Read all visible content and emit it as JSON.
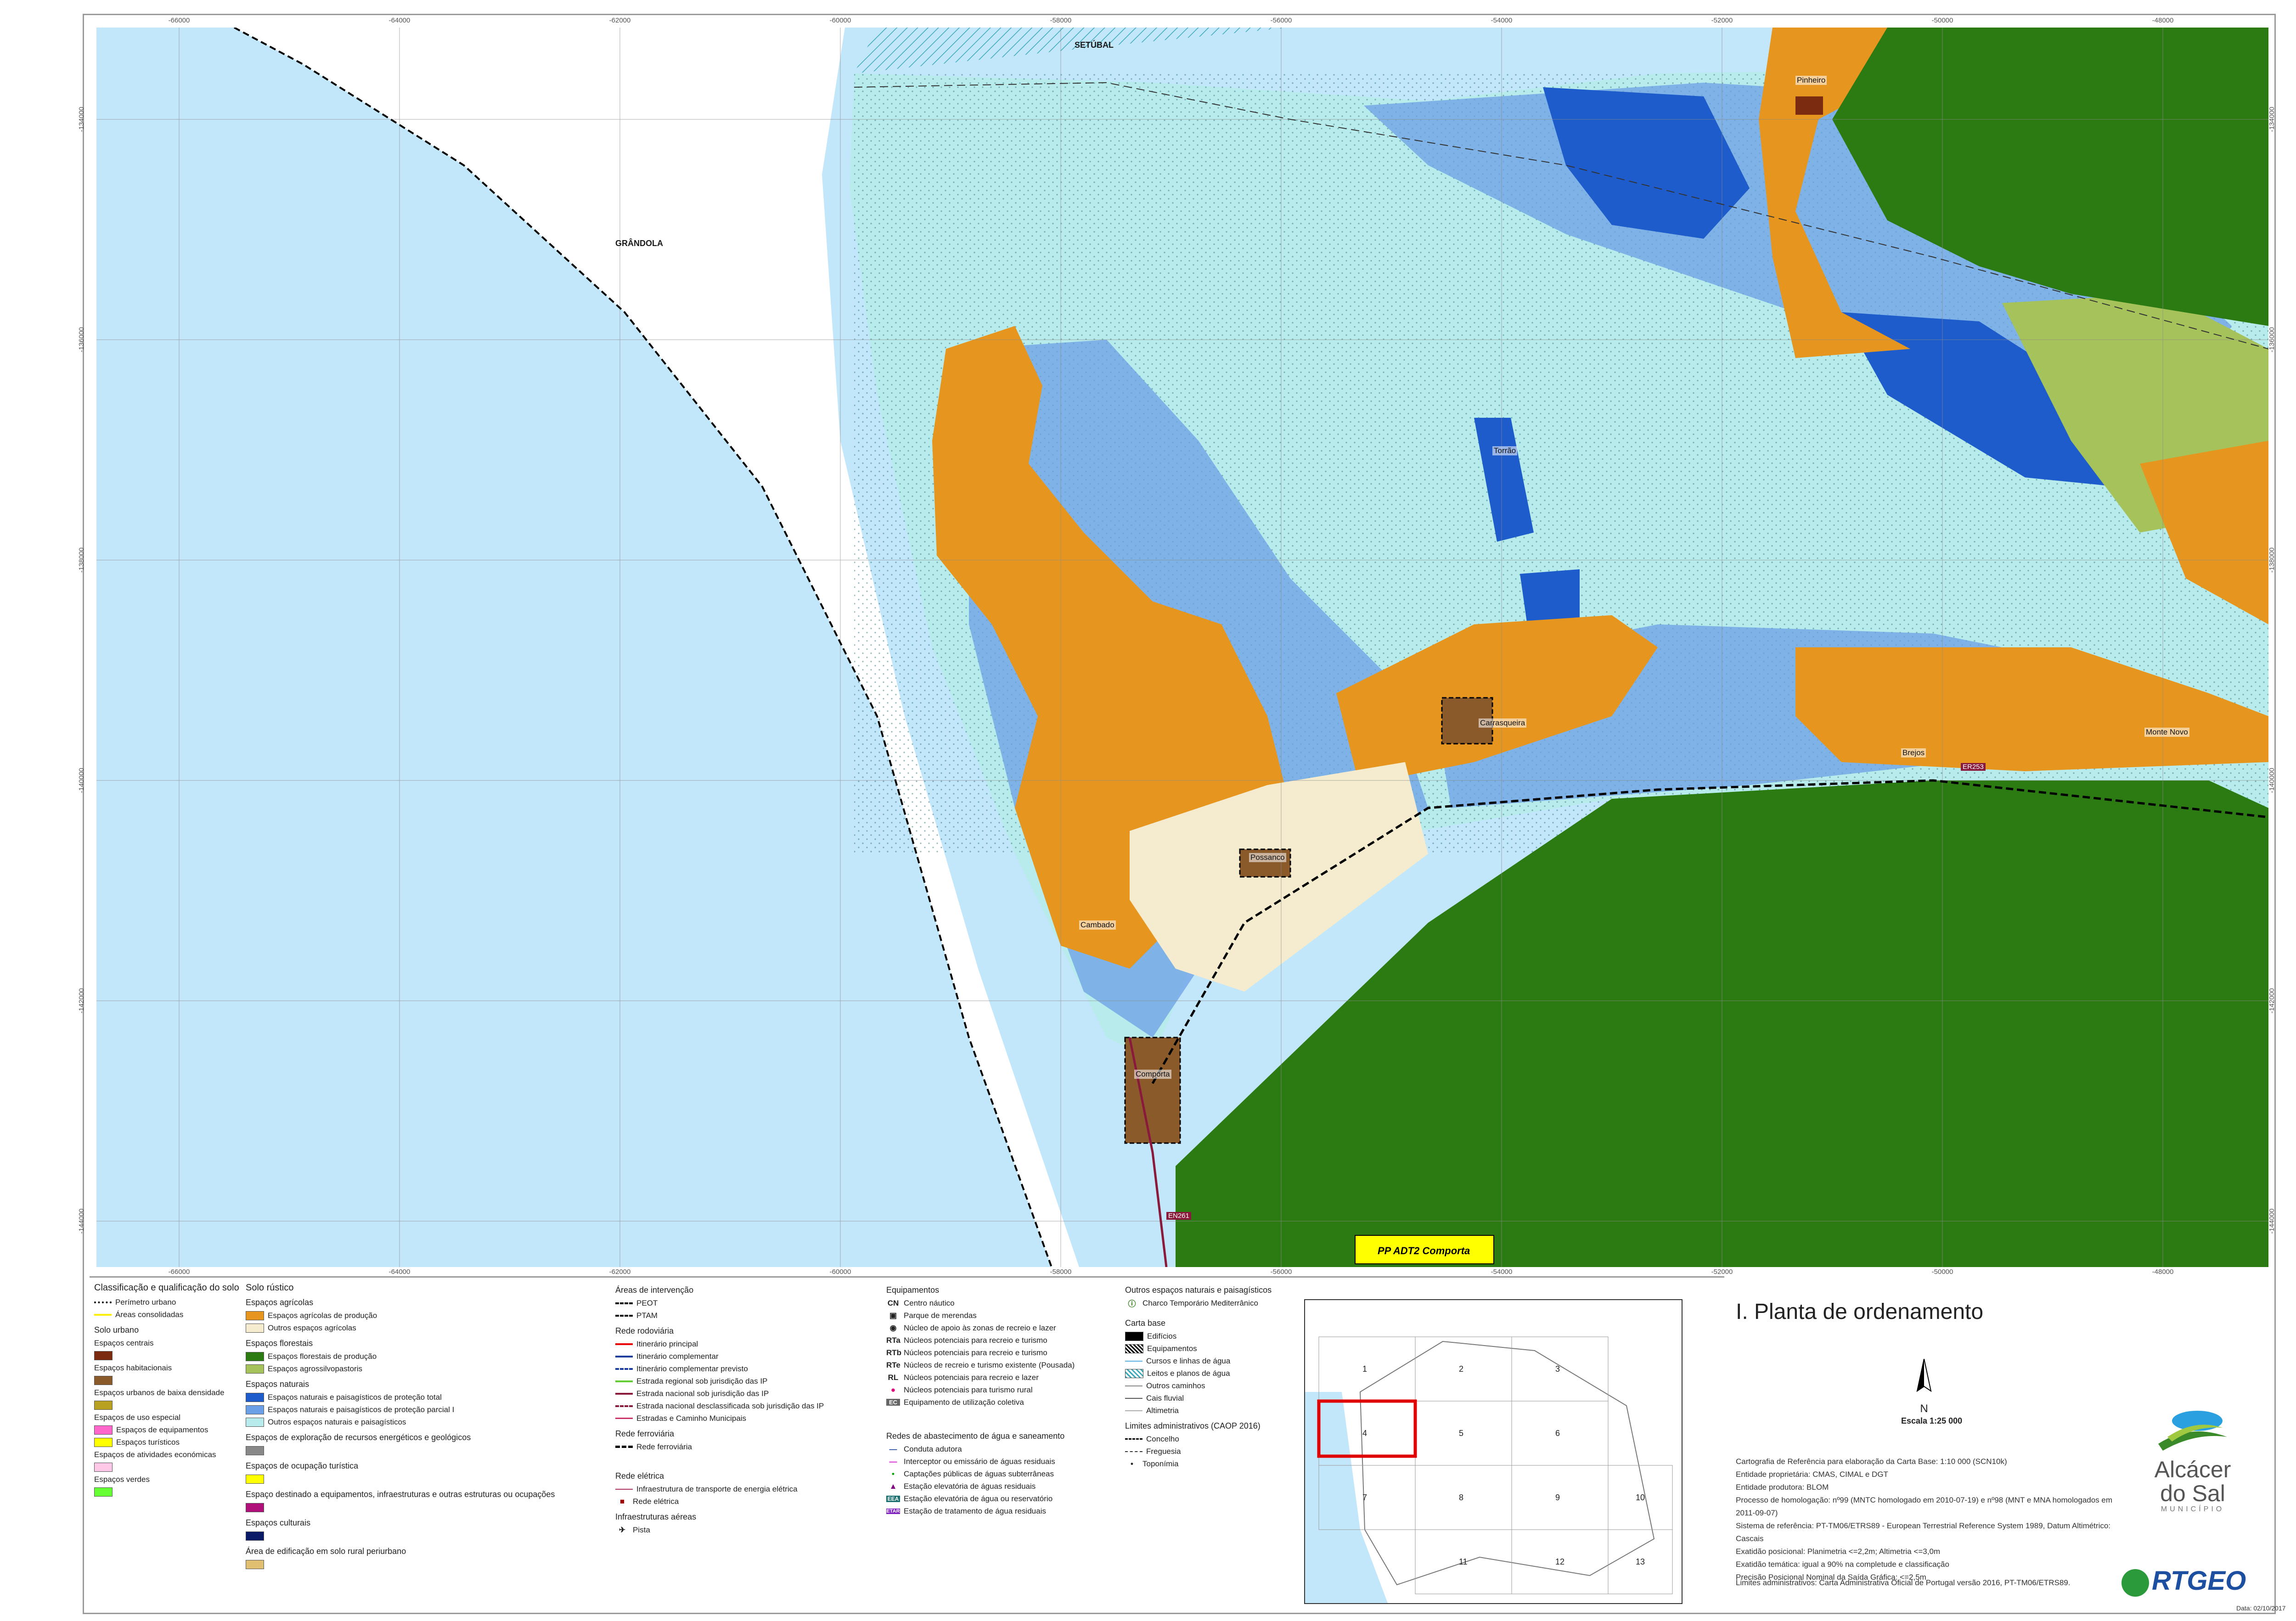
{
  "map": {
    "coords_top": [
      "-66000",
      "-64000",
      "-62000",
      "-60000",
      "-58000",
      "-56000",
      "-54000",
      "-52000",
      "-50000",
      "-48000"
    ],
    "coords_side": [
      "-134000",
      "-136000",
      "-138000",
      "-140000",
      "-142000",
      "-144000"
    ],
    "labels": {
      "setubal": "SETÚBAL",
      "grandola": "GRÂNDOLA"
    },
    "places": {
      "pinheiro": "Pinheiro",
      "torrao": "Torrão",
      "carrasqueira": "Carrasqueira",
      "possanco": "Possanco",
      "comporta": "Comporta",
      "monte_novo": "Monte Novo",
      "brejos": "Brejos",
      "cambado": "Cambado"
    },
    "roads": {
      "en253": "ER253",
      "en261": "EN261"
    },
    "pp_label": "PP ADT2 Comporta"
  },
  "legend": {
    "col1": {
      "heading": "Classificação e qualificação do solo",
      "items": [
        {
          "label": "Perímetro urbano",
          "type": "dash",
          "color": "#000000"
        },
        {
          "label": "Áreas consolidadas",
          "type": "line",
          "color": "#ffee00"
        }
      ],
      "urbano": "Solo urbano",
      "urbano_items": [
        {
          "label": "Espaços centrais",
          "color": "#7a2b10"
        },
        {
          "label": "Espaços habitacionais",
          "color": "#8a5a2a"
        },
        {
          "label": "Espaços urbanos de baixa densidade",
          "color": "#b8a020"
        },
        {
          "label": "Espaços de uso especial",
          "color": ""
        },
        {
          "label": "Espaços de equipamentos",
          "color": "#ff66cc"
        },
        {
          "label": "Espaços turísticos",
          "color": "#ffff00"
        },
        {
          "label": "Espaços de atividades económicas",
          "color": "#ffc8e6"
        },
        {
          "label": "Espaços verdes",
          "color": "#66ff33"
        }
      ]
    },
    "col2": {
      "heading": "Solo rústico",
      "groups": [
        {
          "title": "Espaços agrícolas",
          "items": [
            {
              "label": "Espaços agrícolas de produção",
              "color": "#e6961e"
            },
            {
              "label": "Outros espaços agrícolas",
              "color": "#f5ecd0"
            }
          ]
        },
        {
          "title": "Espaços florestais",
          "items": [
            {
              "label": "Espaços florestais de produção",
              "color": "#2b7a12"
            },
            {
              "label": "Espaços agrossilvopastoris",
              "color": "#a6c25a"
            }
          ]
        },
        {
          "title": "Espaços naturais",
          "items": [
            {
              "label": "Espaços naturais e paisagísticos de proteção total",
              "color": "#1e5ccc"
            },
            {
              "label": "Espaços naturais e paisagísticos de proteção parcial I",
              "color": "#6ca0e6"
            },
            {
              "label": "Outros espaços naturais e paisagísticos",
              "color": "#b8ecec"
            }
          ]
        },
        {
          "title": "Espaços de exploração de recursos energéticos e geológicos",
          "items": [
            {
              "label": "",
              "color": "#888888"
            }
          ]
        },
        {
          "title": "Espaços de ocupação turística",
          "items": [
            {
              "label": "",
              "color": "#ffff00"
            }
          ]
        },
        {
          "title": "Espaço destinado a equipamentos, infraestruturas e outras estruturas ou ocupações",
          "items": [
            {
              "label": "",
              "color": "#b0107a"
            }
          ]
        },
        {
          "title": "Espaços culturais",
          "items": [
            {
              "label": "",
              "color": "#0a1a66"
            }
          ]
        },
        {
          "title": "Área de edificação em solo rural periurbano",
          "items": [
            {
              "label": "",
              "color": "#e0c070"
            }
          ]
        }
      ]
    },
    "col3": {
      "areas_heading": "Áreas de intervenção",
      "areas": [
        "PEOT",
        "PTAM"
      ],
      "rodo_heading": "Rede rodoviária",
      "rodo": [
        {
          "label": "Itinerário principal",
          "color": "#e60000",
          "style": "solid"
        },
        {
          "label": "Itinerário complementar",
          "color": "#1a3c9c",
          "style": "solid"
        },
        {
          "label": "Itinerário complementar previsto",
          "color": "#1a3c9c",
          "style": "dashed"
        },
        {
          "label": "Estrada regional sob jurisdição das IP",
          "color": "#66cc33",
          "style": "solid"
        },
        {
          "label": "Estrada nacional sob jurisdição das IP",
          "color": "#8a1a3c",
          "style": "solid"
        },
        {
          "label": "Estrada nacional desclassificada sob jurisdição das IP",
          "color": "#8a1a3c",
          "style": "dashed"
        },
        {
          "label": "Estradas e Caminho Municipais",
          "color": "#cc3366",
          "style": "solid"
        }
      ],
      "ferro_heading": "Rede ferroviária",
      "ferro": "Rede ferroviária",
      "elec_heading": "Rede elétrica",
      "elec": [
        "Infraestrutura de transporte de energia elétrica",
        "Rede elétrica"
      ],
      "aereo_heading": "Infraestruturas aéreas",
      "aereo": "Pista"
    },
    "col4": {
      "heading": "Equipamentos",
      "items": [
        {
          "code": "CN",
          "label": "Centro náutico"
        },
        {
          "code": "▣",
          "label": "Parque de merendas"
        },
        {
          "code": "◉",
          "label": "Núcleo de apoio às zonas de recreio e lazer"
        },
        {
          "code": "RTa",
          "label": "Núcleos potenciais para recreio e turismo"
        },
        {
          "code": "RTb",
          "label": "Núcleos potenciais para recreio e turismo"
        },
        {
          "code": "RTe",
          "label": "Núcleos de recreio e turismo existente (Pousada)"
        },
        {
          "code": "RL",
          "label": "Núcleos potenciais para recreio e lazer"
        },
        {
          "code": "●",
          "label": "Núcleos potenciais para turismo rural"
        },
        {
          "code": "EC",
          "label": "Equipamento de utilização coletiva"
        }
      ],
      "agua_heading": "Redes de abastecimento de água e saneamento",
      "agua": [
        {
          "code": "—",
          "label": "Conduta adutora"
        },
        {
          "code": "—",
          "label": "Interceptor ou emissário de águas residuais"
        },
        {
          "code": "•",
          "label": "Captações públicas de águas subterrâneas"
        },
        {
          "code": "▲",
          "label": "Estação elevatória de águas residuais"
        },
        {
          "code": "EEA",
          "label": "Estação elevatória de água ou reservatório"
        },
        {
          "code": "ETAR",
          "label": "Estação de tratamento de água residuais"
        }
      ]
    },
    "col5": {
      "heading": "Outros espaços naturais e paisagísticos",
      "charco": "Charco Temporário Mediterrânico",
      "base_heading": "Carta base",
      "base": [
        "Edifícios",
        "Equipamentos",
        "Cursos e linhas de água",
        "Leitos e planos de água",
        "Outros caminhos",
        "Cais fluvial",
        "Altimetria"
      ],
      "limites_heading": "Limites administrativos (CAOP 2016)",
      "limites": [
        "Concelho",
        "Freguesia",
        "Toponímia"
      ]
    }
  },
  "inset": {
    "cells": [
      "1",
      "2",
      "3",
      "4",
      "5",
      "6",
      "7",
      "8",
      "9",
      "10",
      "11",
      "12",
      "13"
    ]
  },
  "title": "I. Planta de ordenamento",
  "north": "N",
  "scale": "Escala 1:25 000",
  "meta": [
    "Cartografia de Referência para elaboração da Carta Base: 1:10 000 (SCN10k)",
    "Entidade proprietária: CMAS, CIMAL e DGT",
    "Entidade produtora: BLOM",
    "Processo de homologação: nº99 (MNTC homologado em 2010-07-19) e nº98 (MNT e MNA homologados em 2011-09-07)",
    "Sistema de referência: PT-TM06/ETRS89 - European Terrestrial Reference System 1989, Datum Altimétrico: Cascais",
    "Exatidão posicional: Planimetria <=2,2m; Altimetria <=3,0m",
    "Exatidão temática: igual a 90% na completude e classificação",
    "Precisão Posicional Nominal da Saída Gráfica: <=2,5m"
  ],
  "admin": "Limites administrativos: Carta Administrativa Oficial de Portugal versão 2016, PT-TM06/ETRS89.",
  "date": "Data: 02/10/2017",
  "logo_alc": {
    "line1": "Alcácer",
    "line2": "do Sal",
    "line3": "MUNICÍPIO"
  },
  "logo_rt": "RTGEO",
  "colors": {
    "sea": "#c2e6fa",
    "dunes": "#b8ecec",
    "agri": "#e6961e",
    "forest": "#2b7a12",
    "prot_total": "#1e5ccc",
    "prot_partial": "#6ca0e6"
  }
}
